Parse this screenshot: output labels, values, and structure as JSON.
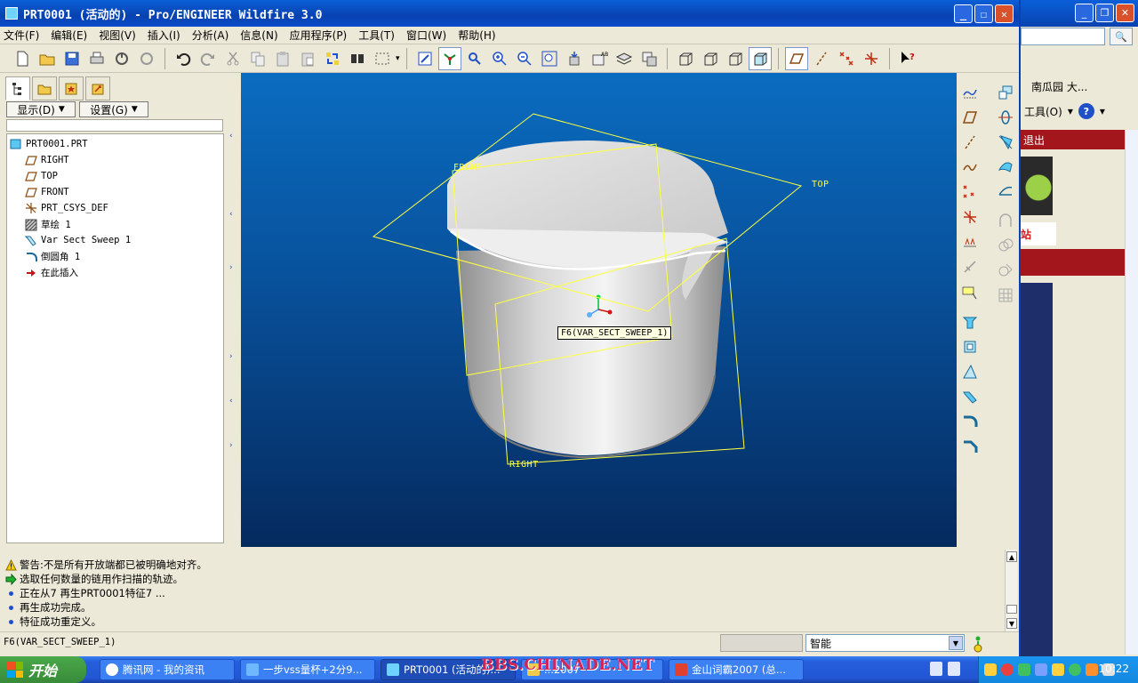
{
  "window": {
    "title": "PRT0001 (活动的) - Pro/ENGINEER Wildfire 3.0"
  },
  "menu": {
    "items": [
      "文件(F)",
      "编辑(E)",
      "视图(V)",
      "插入(I)",
      "分析(A)",
      "信息(N)",
      "应用程序(P)",
      "工具(T)",
      "窗口(W)",
      "帮助(H)"
    ]
  },
  "toolbar": {
    "icons": [
      "new-icon",
      "open-icon",
      "save-icon",
      "print-icon",
      "email-icon",
      "email-link-icon",
      "undo-icon",
      "redo-icon",
      "cut-icon",
      "copy-icon",
      "paste-icon",
      "paste-special-icon",
      "regenerate-icon",
      "find-icon",
      "select-box-icon",
      "repaint-icon",
      "spin-center-icon",
      "orient-icon",
      "zoom-in-icon",
      "zoom-out-icon",
      "refit-icon",
      "reorient-icon",
      "saved-views-icon",
      "layers-icon",
      "view-manager-icon",
      "wireframe-icon",
      "hidden-line-icon",
      "no-hidden-icon",
      "shading-icon",
      "datum-planes-icon",
      "datum-axes-icon",
      "datum-points-icon",
      "coordinate-systems-icon",
      "context-help-icon"
    ]
  },
  "model_tree": {
    "display_button": "显示(D)",
    "settings_button": "设置(G)",
    "root": "PRT0001.PRT",
    "items": [
      {
        "label": "RIGHT",
        "icon": "datum-plane-icon"
      },
      {
        "label": "TOP",
        "icon": "datum-plane-icon"
      },
      {
        "label": "FRONT",
        "icon": "datum-plane-icon"
      },
      {
        "label": "PRT_CSYS_DEF",
        "icon": "csys-icon"
      },
      {
        "label": "草绘 1",
        "icon": "sketch-icon"
      },
      {
        "label": "Var Sect Sweep 1",
        "icon": "sweep-icon"
      },
      {
        "label": "倒圆角 1",
        "icon": "round-icon"
      },
      {
        "label": "在此插入",
        "icon": "insert-here-icon"
      }
    ]
  },
  "viewport": {
    "datum_labels": {
      "front": "FRONT",
      "top": "TOP",
      "right": "RIGHT"
    },
    "tooltip": "F6(VAR_SECT_SWEEP_1)"
  },
  "messages": [
    {
      "icon": "warning-icon",
      "text": "警告:不是所有开放端都已被明确地对齐。"
    },
    {
      "icon": "prompt-arrow-icon",
      "text": "选取任何数量的链用作扫描的轨迹。"
    },
    {
      "icon": "bullet-icon",
      "text": "正在从7 再生PRT0001特征7 ..."
    },
    {
      "icon": "bullet-icon",
      "text": "再生成功完成。"
    },
    {
      "icon": "bullet-icon",
      "text": "特征成功重定义。"
    }
  ],
  "statusbar": {
    "text": "F6(VAR_SECT_SWEEP_1)",
    "filter_value": "智能"
  },
  "background_browser": {
    "link_text": "南瓜园 大...",
    "tools_label": "工具(O)",
    "exit_label": "退出",
    "site_tag": "站"
  },
  "taskbar": {
    "start_label": "开始",
    "tasks": [
      {
        "label": "腾讯网 - 我的资讯",
        "icon": "chrome-like-icon"
      },
      {
        "label": "一步vss量杯+2分9...",
        "icon": "ie-icon"
      },
      {
        "label": "PRT0001 (活动的)...",
        "icon": "proe-icon"
      },
      {
        "label": "...2007",
        "icon": "folder-icon"
      },
      {
        "label": "金山词霸2007 (总...",
        "icon": "kingsoft-icon"
      }
    ],
    "watermark": "BBS.CHINADE.NET",
    "clock": "10:22"
  },
  "colors": {
    "datum": "#ffff40",
    "viewport_top": "#0a6cc0",
    "viewport_bottom": "#052a5e",
    "titlebar": "#0a5fd8"
  }
}
